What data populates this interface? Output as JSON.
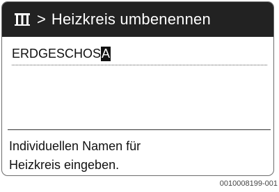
{
  "title_bar": {
    "icon": "radiator-icon",
    "separator": ">",
    "title": "Heizkreis umbenennen"
  },
  "name_field": {
    "value_prefix": "ERDGESCHOS",
    "cursor_char": "A"
  },
  "help": {
    "line1": "Individuellen Namen für",
    "line2": "Heizkreis eingeben."
  },
  "footer": {
    "code": "0010008199-001"
  }
}
